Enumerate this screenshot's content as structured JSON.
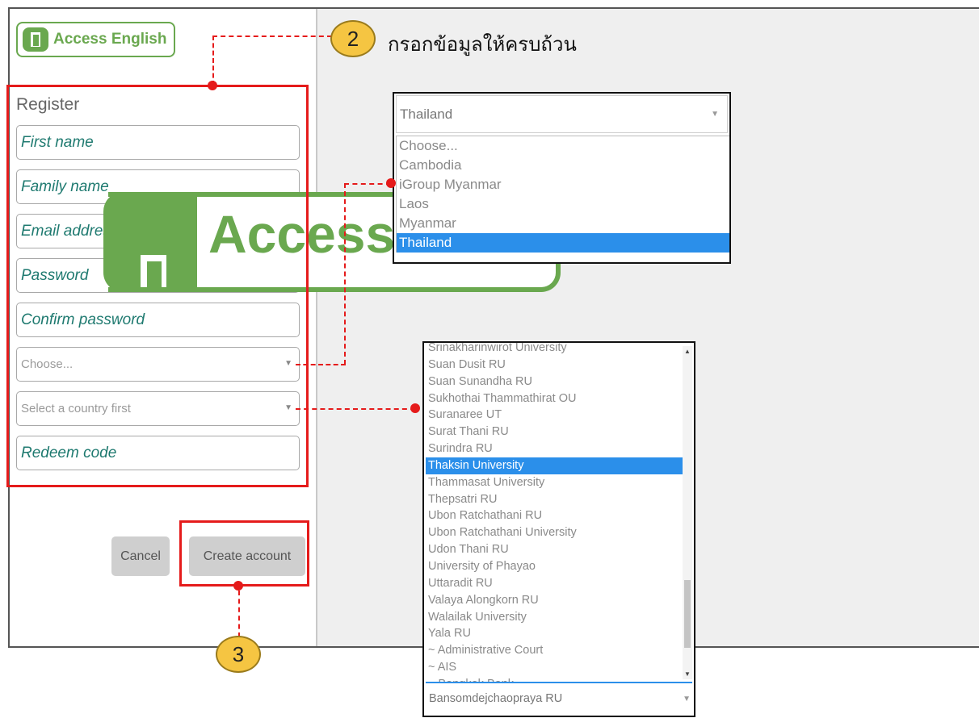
{
  "brand": {
    "name": "Access English",
    "color": "#6aa84f"
  },
  "form": {
    "title": "Register",
    "first_name_placeholder": "First name",
    "family_name_placeholder": "Family name",
    "email_placeholder": "Email address",
    "password_placeholder": "Password",
    "confirm_password_placeholder": "Confirm password",
    "country_select_value": "Choose...",
    "university_select_value": "Select a country first",
    "redeem_code_placeholder": "Redeem code",
    "cancel_label": "Cancel",
    "create_account_label": "Create account"
  },
  "annotations": {
    "step2_number": "2",
    "step2_text": "กรอกข้อมูลให้ครบถ้วน",
    "step3_number": "3",
    "highlight_color": "#e51b1b"
  },
  "country_dropdown": {
    "selected": "Thailand",
    "options": [
      "Choose...",
      "Cambodia",
      "iGroup Myanmar",
      "Laos",
      "Myanmar",
      "Thailand"
    ],
    "active_index": 5
  },
  "university_dropdown": {
    "selected": "Bansomdejchaopraya RU",
    "options": [
      "Srinakharinwirot University",
      "Suan Dusit RU",
      "Suan Sunandha RU",
      "Sukhothai Thammathirat OU",
      "Suranaree UT",
      "Surat Thani RU",
      "Surindra RU",
      "Thaksin University",
      "Thammasat University",
      "Thepsatri RU",
      "Ubon Ratchathani RU",
      "Ubon Ratchathani University",
      "Udon Thani RU",
      "University of Phayao",
      "Uttaradit RU",
      "Valaya Alongkorn RU",
      "Walailak University",
      "Yala RU",
      "~ Administrative Court",
      "~ AIS",
      "~ Bangkok Bank"
    ],
    "active_index": 7
  }
}
